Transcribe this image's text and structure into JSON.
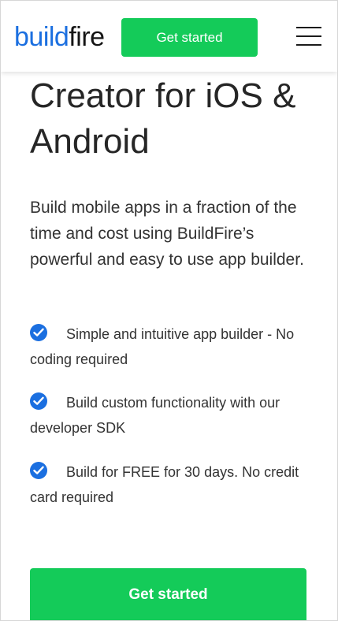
{
  "header": {
    "logo_part_a": "build",
    "logo_part_b": "fire",
    "cta_label": "Get started",
    "menu_icon": "hamburger-menu-icon"
  },
  "hero": {
    "title_line_1": "Creator for iOS &",
    "title_line_2": "Android",
    "lead": "Build mobile apps in a fraction of the time and cost using BuildFire’s powerful and easy to use app builder."
  },
  "features": [
    {
      "icon": "check-circle-icon",
      "text": "Simple and intuitive app builder - No coding required"
    },
    {
      "icon": "check-circle-icon",
      "text": "Build custom functionality with our developer SDK"
    },
    {
      "icon": "check-circle-icon",
      "text": "Build for FREE for 30 days. No credit card required"
    }
  ],
  "footer_cta": {
    "label": "Get started"
  },
  "colors": {
    "brand_blue": "#1b6fe0",
    "cta_green": "#14cb59",
    "text_dark": "#262626"
  }
}
